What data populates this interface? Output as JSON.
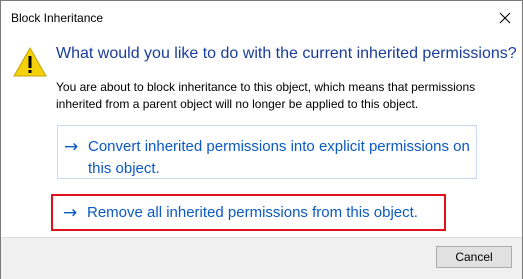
{
  "window": {
    "title": "Block Inheritance",
    "close_icon": "close-icon"
  },
  "content": {
    "warning_icon": "warning-icon",
    "heading": "What would you like to do with the current inherited permissions?",
    "description": "You are about to block inheritance to this object, which means that permissions inherited from a parent object will no longer be applied to this object."
  },
  "options": [
    {
      "arrow": "→",
      "label": "Convert inherited permissions into explicit permissions on this object."
    },
    {
      "arrow": "→",
      "label": "Remove all inherited permissions from this object.",
      "highlighted": true,
      "highlight_color": "#e01020"
    }
  ],
  "footer": {
    "cancel_label": "Cancel"
  },
  "colors": {
    "heading": "#1a3d99",
    "link": "#0a5ac2",
    "warning_fill": "#f5d10a",
    "highlight": "#e01020"
  }
}
